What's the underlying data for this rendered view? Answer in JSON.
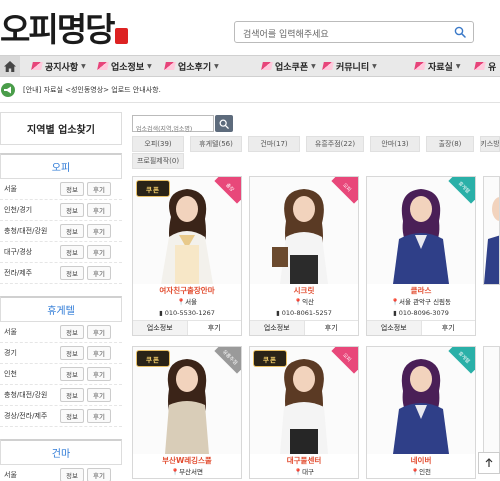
{
  "header": {
    "logo_text": "오피명당",
    "logo_seal": "오피명당",
    "search_placeholder": "검색어를 입력해주세요"
  },
  "nav": {
    "items": [
      {
        "label": "공지사항"
      },
      {
        "label": "업소정보"
      },
      {
        "label": "업소후기"
      },
      {
        "label": "업소쿠폰"
      },
      {
        "label": "커뮤니티"
      },
      {
        "label": "자료실"
      },
      {
        "label": "유"
      }
    ]
  },
  "notice": {
    "text": "[안내] 자료실 <성인동영상> 업로드 안내사항."
  },
  "sidebar": {
    "title": "지역별 업소찾기",
    "info_label": "정보",
    "review_label": "후기",
    "sections": [
      {
        "title": "오피",
        "rows": [
          "서울",
          "인천/경기",
          "충청/대전/강원",
          "대구/경상",
          "전라/제주"
        ]
      },
      {
        "title": "휴게텔",
        "rows": [
          "서울",
          "경기",
          "인천",
          "충청/대전/강원",
          "경상/전라/제주"
        ]
      },
      {
        "title": "건마",
        "rows": [
          "서울"
        ]
      }
    ]
  },
  "main": {
    "search_placeholder": "업소검색(지역,업소명)",
    "tabs": [
      "오피(39)",
      "휴게텔(56)",
      "건마(17)",
      "유흥주점(22)",
      "안마(13)",
      "출장(8)",
      "키스방",
      "프로필제작(0)"
    ],
    "card_info_label": "업소정보",
    "card_review_label": "후기",
    "cards": [
      {
        "name": "여자친구출장안마",
        "location": "서울",
        "phone": "010-5530-1267",
        "badge": "출장",
        "badge_color": "#e8487a",
        "coupon": "쿠폰"
      },
      {
        "name": "시크릿",
        "location": "익산",
        "phone": "010-8061-5257",
        "badge": "오피",
        "badge_color": "#e8487a",
        "coupon": ""
      },
      {
        "name": "클라스",
        "location": "서울 관악구 신림동",
        "phone": "010-8096-3079",
        "badge": "휴게텔",
        "badge_color": "#2ab0a8",
        "coupon": ""
      },
      {
        "name": "부산W레깅스풀",
        "location": "부산서면",
        "phone": "",
        "badge": "유흥주점",
        "badge_color": "#9a9a9a",
        "coupon": "쿠폰"
      },
      {
        "name": "대구풀센터",
        "location": "대구",
        "phone": "",
        "badge": "오피",
        "badge_color": "#e8487a",
        "coupon": "쿠폰"
      },
      {
        "name": "네이버",
        "location": "인천",
        "phone": "",
        "badge": "휴게텔",
        "badge_color": "#2ab0a8",
        "coupon": ""
      }
    ]
  },
  "colors": {
    "accent_pink": "#e7447a",
    "card_name": "#e24c2f",
    "section_blue": "#2b78d6",
    "notice_green": "#4a9d4a"
  }
}
